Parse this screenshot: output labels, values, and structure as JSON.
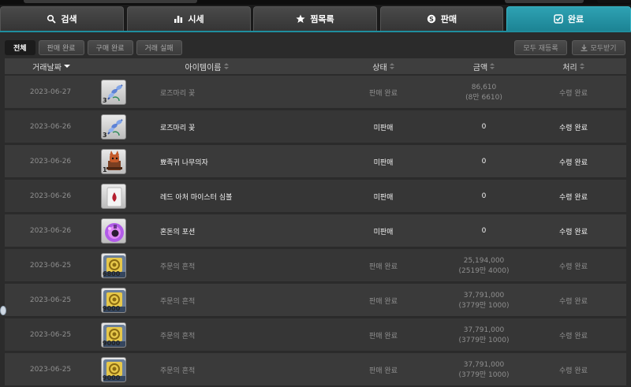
{
  "tabs": [
    {
      "label": "검색",
      "icon": "search-icon",
      "active": false
    },
    {
      "label": "시세",
      "icon": "bar-chart-icon",
      "active": false
    },
    {
      "label": "찜목록",
      "icon": "star-icon",
      "active": false
    },
    {
      "label": "판매",
      "icon": "coin-icon",
      "active": false
    },
    {
      "label": "완료",
      "icon": "checkbox-icon",
      "active": true
    }
  ],
  "filters": [
    "전체",
    "판매 완료",
    "구매 완료",
    "거래 실패"
  ],
  "selected_filter": "전체",
  "actions": {
    "relist_all": "모두 재등록",
    "receive_all": "모두받기"
  },
  "columns": {
    "date": "거래날짜",
    "item": "아이템이름",
    "status": "상태",
    "amount": "금액",
    "process": "처리"
  },
  "rows": [
    {
      "date": "2023-06-27",
      "icon": "rosemary-flower-icon",
      "qty": "3",
      "name": "로즈마리 꽃",
      "status": "판매 완료",
      "amount": "86,610",
      "amount_sub": "(8만 6610)",
      "process": "수령 완료",
      "highlight": false
    },
    {
      "date": "2023-06-26",
      "icon": "rosemary-flower-icon",
      "qty": "3",
      "name": "로즈마리 꽃",
      "status": "미판매",
      "amount": "0",
      "amount_sub": "",
      "process": "수령 완료",
      "highlight": true
    },
    {
      "date": "2023-06-26",
      "icon": "fox-chair-icon",
      "qty": "1",
      "name": "뾰족귀 나무의자",
      "status": "미판매",
      "amount": "0",
      "amount_sub": "",
      "process": "수령 완료",
      "highlight": true
    },
    {
      "date": "2023-06-26",
      "icon": "archer-symbol-icon",
      "qty": "",
      "name": "레드 아처 마이스터 심볼",
      "status": "미판매",
      "amount": "0",
      "amount_sub": "",
      "process": "수령 완료",
      "highlight": true
    },
    {
      "date": "2023-06-26",
      "icon": "chaos-potion-icon",
      "qty": "",
      "name": "혼돈의 포션",
      "status": "미판매",
      "amount": "0",
      "amount_sub": "",
      "process": "수령 완료",
      "highlight": true
    },
    {
      "date": "2023-06-25",
      "icon": "spell-trace-icon",
      "qty": "6800",
      "name": "주문의 흔적",
      "status": "판매 완료",
      "amount": "25,194,000",
      "amount_sub": "(2519만 4000)",
      "process": "수령 완료",
      "highlight": false
    },
    {
      "date": "2023-06-25",
      "icon": "spell-trace-icon",
      "qty": "9000",
      "name": "주문의 흔적",
      "status": "판매 완료",
      "amount": "37,791,000",
      "amount_sub": "(3779만 1000)",
      "process": "수령 완료",
      "highlight": false
    },
    {
      "date": "2023-06-25",
      "icon": "spell-trace-icon",
      "qty": "9000",
      "name": "주문의 흔적",
      "status": "판매 완료",
      "amount": "37,791,000",
      "amount_sub": "(3779만 1000)",
      "process": "수령 완료",
      "highlight": false
    },
    {
      "date": "2023-06-25",
      "icon": "spell-trace-icon",
      "qty": "9000",
      "name": "주문의 흔적",
      "status": "판매 완료",
      "amount": "37,791,000",
      "amount_sub": "(3779만 1000)",
      "process": "수령 완료",
      "highlight": false
    }
  ],
  "colors": {
    "accent": "#1f8e9e",
    "bright_text": "#f2f2f2",
    "dim_text": "#8f8f8f"
  }
}
